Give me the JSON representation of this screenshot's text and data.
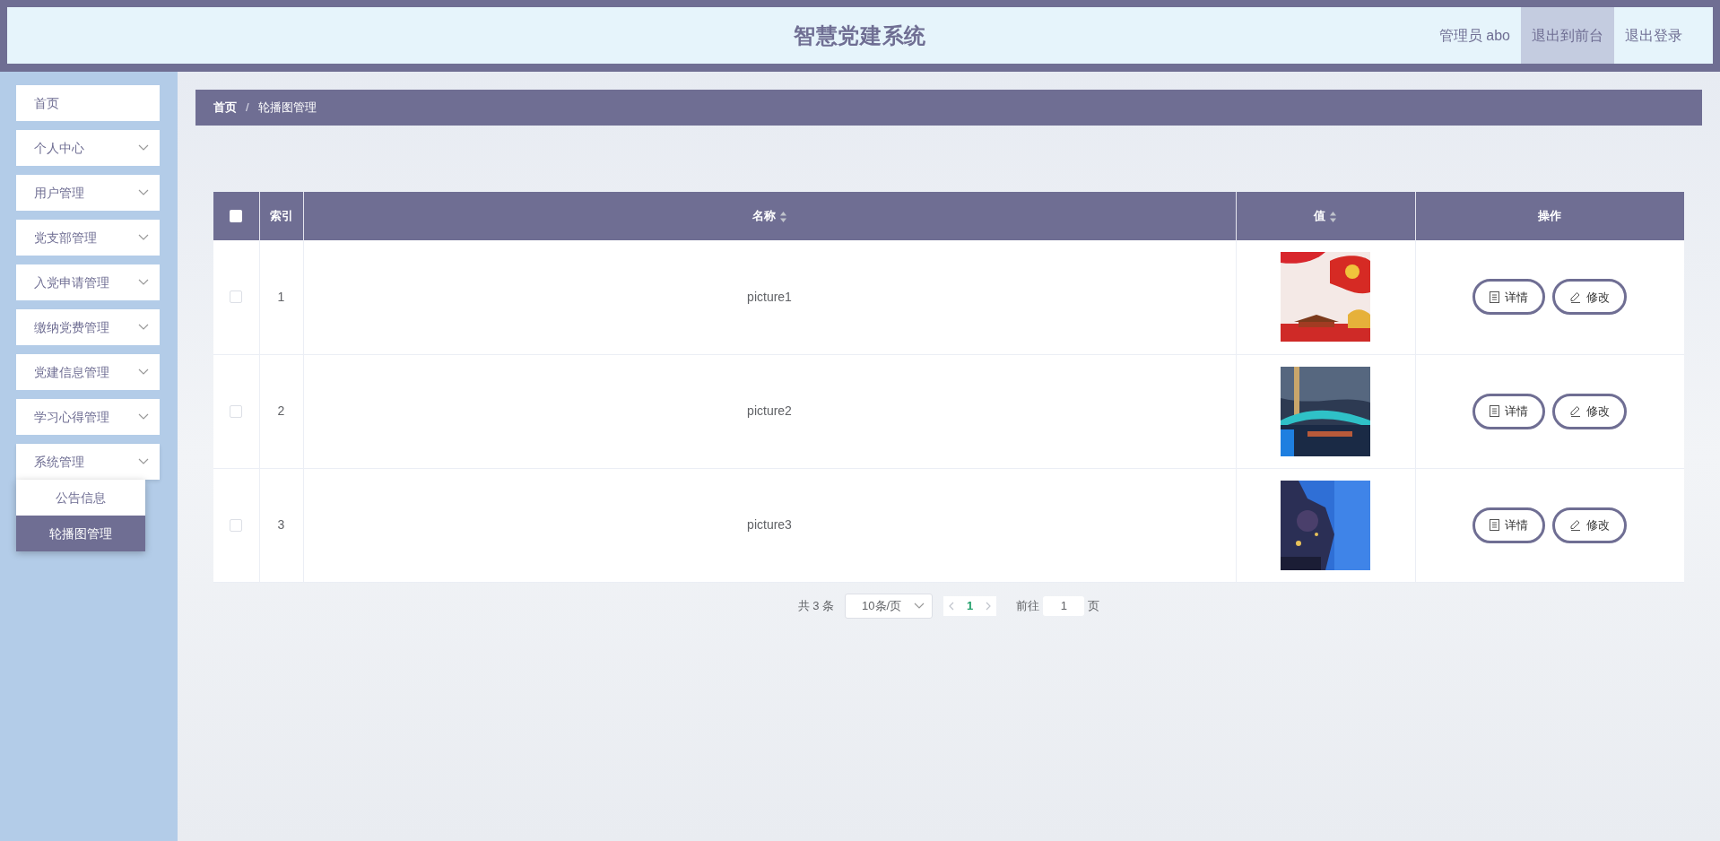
{
  "header": {
    "title": "智慧党建系统",
    "user": "管理员 abo",
    "buttons": [
      {
        "label": "退出到前台",
        "selected": true
      },
      {
        "label": "退出登录",
        "selected": false
      }
    ]
  },
  "sidebar": {
    "items": [
      {
        "label": "首页",
        "has_arrow": false,
        "expanded": false
      },
      {
        "label": "个人中心",
        "has_arrow": true,
        "expanded": false
      },
      {
        "label": "用户管理",
        "has_arrow": true,
        "expanded": false
      },
      {
        "label": "党支部管理",
        "has_arrow": true,
        "expanded": false
      },
      {
        "label": "入党申请管理",
        "has_arrow": true,
        "expanded": false
      },
      {
        "label": "缴纳党费管理",
        "has_arrow": true,
        "expanded": false
      },
      {
        "label": "党建信息管理",
        "has_arrow": true,
        "expanded": false
      },
      {
        "label": "学习心得管理",
        "has_arrow": true,
        "expanded": false
      },
      {
        "label": "系统管理",
        "has_arrow": true,
        "expanded": true,
        "children": [
          {
            "label": "公告信息",
            "selected": false
          },
          {
            "label": "轮播图管理",
            "selected": true
          }
        ]
      }
    ]
  },
  "breadcrumb": {
    "separator": "/",
    "items": [
      "首页",
      "轮播图管理"
    ]
  },
  "table": {
    "select_all": {
      "checked": false
    },
    "columns": [
      {
        "label": "索引",
        "sortable": false
      },
      {
        "label": "名称",
        "sortable": true
      },
      {
        "label": "值",
        "sortable": true
      },
      {
        "label": "操作",
        "sortable": false
      }
    ],
    "rows": [
      {
        "checked": false,
        "index": "1",
        "name": "picture1",
        "value": {
          "kind": "picture"
        },
        "actions": [
          "详情",
          "修改"
        ]
      },
      {
        "checked": false,
        "index": "2",
        "name": "picture2",
        "value": {
          "kind": "picture"
        },
        "actions": [
          "详情",
          "修改"
        ]
      },
      {
        "checked": false,
        "index": "3",
        "name": "picture3",
        "value": {
          "kind": "picture"
        },
        "actions": [
          "详情",
          "修改"
        ]
      }
    ]
  },
  "pagination": {
    "total": "共 3 条",
    "page_size": "10条/页",
    "pages": [
      {
        "label": "1",
        "selected": true
      }
    ],
    "goto_label": "前往",
    "goto_value": "1",
    "goto_suffix": "页"
  }
}
